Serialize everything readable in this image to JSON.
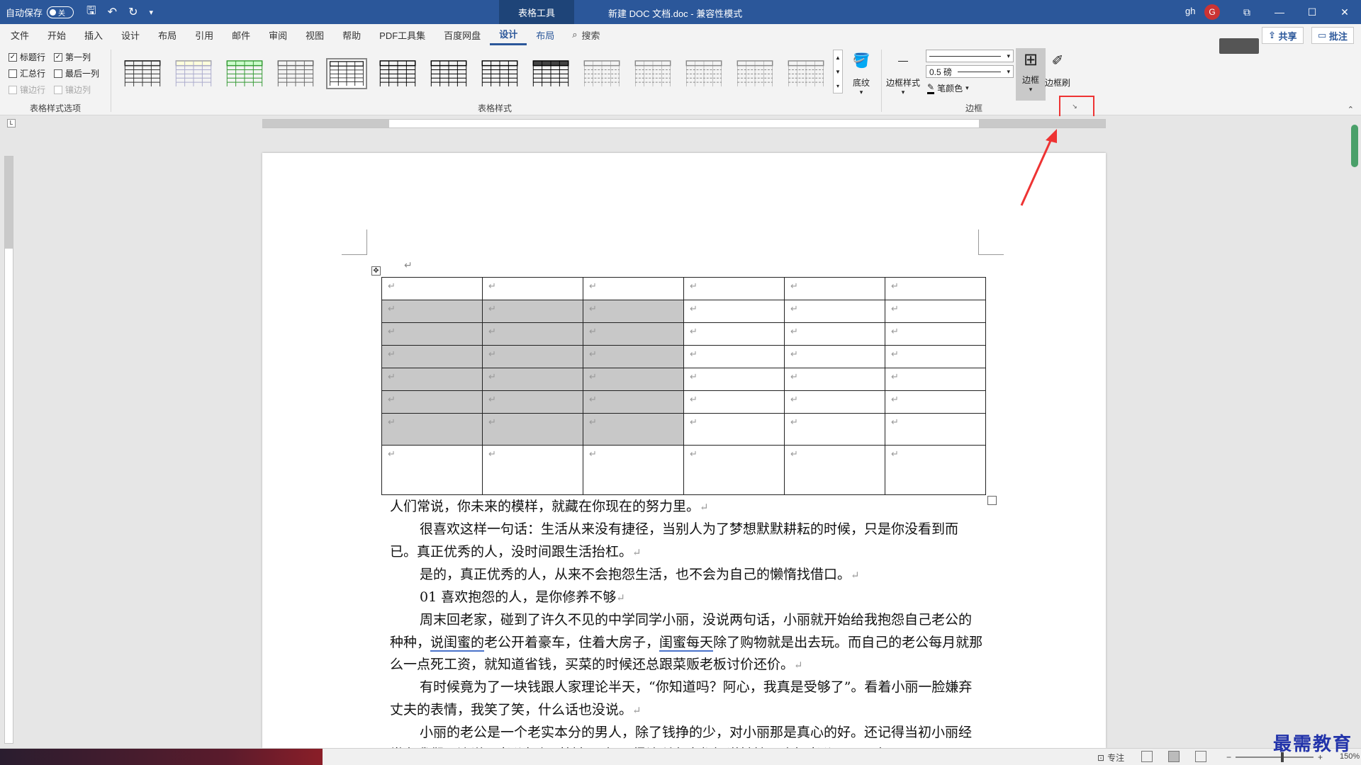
{
  "titlebar": {
    "autosave_label": "自动保存",
    "autosave_state": "关",
    "context_tab": "表格工具",
    "doc_title": "新建 DOC 文档.doc  -  兼容性模式",
    "user": "gh",
    "avatar_initial": "G"
  },
  "menu": {
    "tabs": [
      "文件",
      "开始",
      "插入",
      "设计",
      "布局",
      "引用",
      "邮件",
      "审阅",
      "视图",
      "帮助",
      "PDF工具集",
      "百度网盘",
      "设计",
      "布局"
    ],
    "search": "搜索",
    "share": "共享",
    "comment": "批注"
  },
  "ribbon": {
    "table_style_options": {
      "label": "表格样式选项",
      "header_row": "标题行",
      "first_column": "第一列",
      "total_row": "汇总行",
      "last_column": "最后一列",
      "banded_rows": "镶边行",
      "banded_columns": "镶边列"
    },
    "table_styles": {
      "label": "表格样式"
    },
    "shading": "底纹",
    "borders_group": {
      "label": "边框",
      "border_styles": "边框样式",
      "weight": "0.5 磅",
      "pen_color": "笔颜色",
      "borders": "边框",
      "border_painter": "边框刷"
    }
  },
  "document": {
    "table": {
      "columns": 6,
      "rows": 8,
      "shaded_rows": [
        1,
        2,
        3,
        4,
        5,
        6
      ],
      "shaded_cols": [
        0,
        1,
        2
      ],
      "cell_mark": "↵"
    },
    "paragraphs": [
      "人们常说，你未来的模样，就藏在你现在的努力里。",
      "很喜欢这样一句话：生活从来没有捷径，当别人为了梦想默默耕耘的时候，只是你没看到而已。真正优秀的人，没时间跟生活抬杠。",
      "是的，真正优秀的人，从来不会抱怨生活，也不会为自己的懒惰找借口。",
      "01 喜欢抱怨的人，是你修养不够",
      "周末回老家，碰到了许久不见的中学同学小丽，没说两句话，小丽就开始给我抱怨自己老公的种种，说闺蜜的老公开着豪车，住着大房子，闺蜜每天除了购物就是出去玩。而自己的老公每月就那么一点死工资，就知道省钱，买菜的时候还总跟菜贩老板讨价还价。",
      "有时候竟为了一块钱跟人家理论半天，“你知道吗？阿心，我真是受够了”。看着小丽一脸嫌弃丈夫的表情，我笑了笑，什么话也没说。",
      "小丽的老公是一个老实本分的男人，除了钱挣的少，对小丽那是真心的好。还记得当初小丽经常在我们耳边说，老公如何对她好，恨不得让所有人都知道她嫁了个好老公。可现在"
    ]
  },
  "statusbar": {
    "focus": "专注",
    "zoom": "150%"
  },
  "watermark": "最需教育",
  "colors": {
    "brand": "#2b579a",
    "highlight_box": "#ee3333",
    "shade": "#c8c8c8"
  }
}
